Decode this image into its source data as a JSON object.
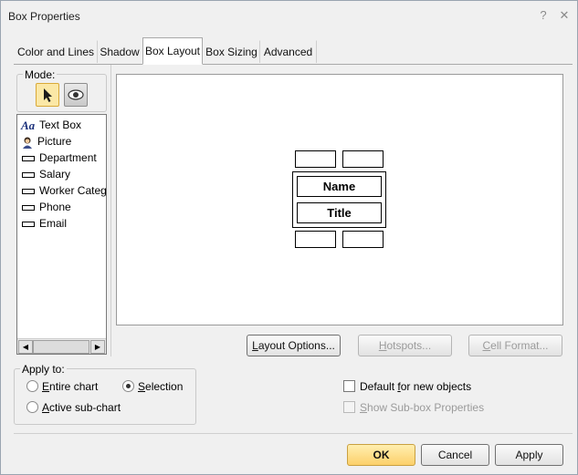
{
  "window": {
    "title": "Box Properties",
    "help_glyph": "?",
    "close_glyph": "✕"
  },
  "tabs": [
    {
      "label": "Color and Lines"
    },
    {
      "label": "Shadow"
    },
    {
      "label": "Box Layout",
      "active": true
    },
    {
      "label": "Box Sizing"
    },
    {
      "label": "Advanced"
    }
  ],
  "mode": {
    "label": "Mode:",
    "buttons": [
      {
        "icon": "cursor-arrow-icon",
        "selected": true
      },
      {
        "icon": "eye-icon",
        "selected": false
      }
    ]
  },
  "fields_list": {
    "items": [
      {
        "label": "Text Box",
        "icon": "text-box-icon"
      },
      {
        "label": "Picture",
        "icon": "picture-icon"
      },
      {
        "label": "Department",
        "icon": "field-icon"
      },
      {
        "label": "Salary",
        "icon": "field-icon"
      },
      {
        "label": "Worker Category",
        "icon": "field-icon"
      },
      {
        "label": "Phone",
        "icon": "field-icon"
      },
      {
        "label": "Email",
        "icon": "field-icon"
      }
    ],
    "scroll_left": "◀",
    "scroll_right": "▶"
  },
  "preview": {
    "fields": [
      {
        "label": "Name"
      },
      {
        "label": "Title"
      }
    ]
  },
  "buttons": {
    "layout_options": {
      "prefix": "",
      "accel": "L",
      "rest": "ayout Options..."
    },
    "hotspots": {
      "accel": "H",
      "rest": "otspots..."
    },
    "cell_format": {
      "accel": "C",
      "rest": "ell Format..."
    }
  },
  "apply_to": {
    "label": "Apply to:",
    "options": [
      {
        "accel": "E",
        "rest": "ntire chart",
        "checked": false
      },
      {
        "accel": "S",
        "rest": "election",
        "checked": true
      },
      {
        "accel": "A",
        "rest": "ctive sub-chart",
        "checked": false
      }
    ]
  },
  "checkboxes": {
    "default_new": {
      "pre": "Default ",
      "accel": "f",
      "rest": "or new objects",
      "checked": false,
      "enabled": true
    },
    "show_subbox": {
      "pre": "",
      "accel": "S",
      "rest": "how Sub-box Properties",
      "checked": false,
      "enabled": false
    }
  },
  "footer": {
    "ok": "OK",
    "cancel": "Cancel",
    "apply": "Apply"
  },
  "colors": {
    "ok_button": "#fcd06a",
    "preview_bg": "#ffffff",
    "dialog_bg": "#f0f0f0"
  }
}
